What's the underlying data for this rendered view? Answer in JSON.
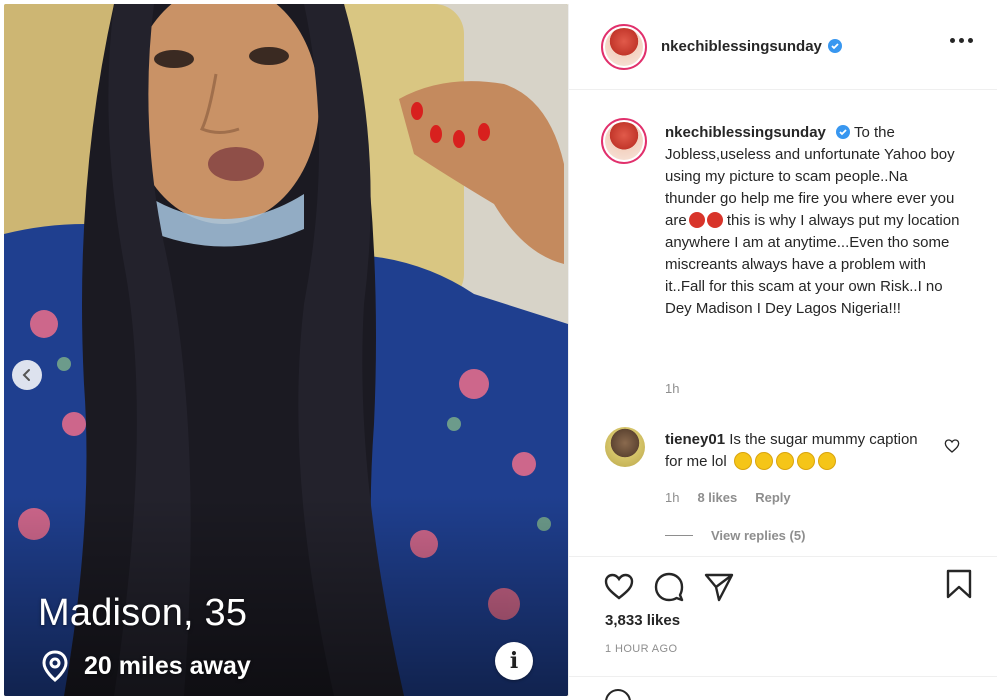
{
  "profile_card": {
    "name_age": "Madison, 35",
    "distance": "20 miles away"
  },
  "post": {
    "username": "nkechiblessingsunday",
    "caption_username": "nkechiblessingsunday",
    "caption_before_emoji": "To the Jobless,useless and unfortunate Yahoo boy using my picture to scam people..Na thunder go help me fire you where ever you are",
    "caption_after_emoji": " this is why I always put my location anywhere I am at anytime...Even tho some miscreants always have a problem with it..Fall for this scam at your own Risk..I no Dey Madison I Dey Lagos Nigeria!!!",
    "caption_time": "1h",
    "comment": {
      "username": "tieney01",
      "text": "Is the sugar mummy caption for me lol",
      "time": "1h",
      "likes": "8 likes",
      "reply_label": "Reply",
      "view_replies": "View replies (5)"
    },
    "likes_count": "3,833 likes",
    "time_ago": "1 HOUR AGO"
  },
  "colors": {
    "verified": "#3897f0",
    "story_ring": "#e1306c",
    "text": "#262626",
    "muted": "#8e8e8e"
  },
  "icons": [
    "chevron-left-icon",
    "location-pin-icon",
    "info-icon",
    "verified-badge-icon",
    "more-options-icon",
    "heart-icon",
    "comment-icon",
    "share-icon",
    "bookmark-icon",
    "emoji-icon"
  ]
}
